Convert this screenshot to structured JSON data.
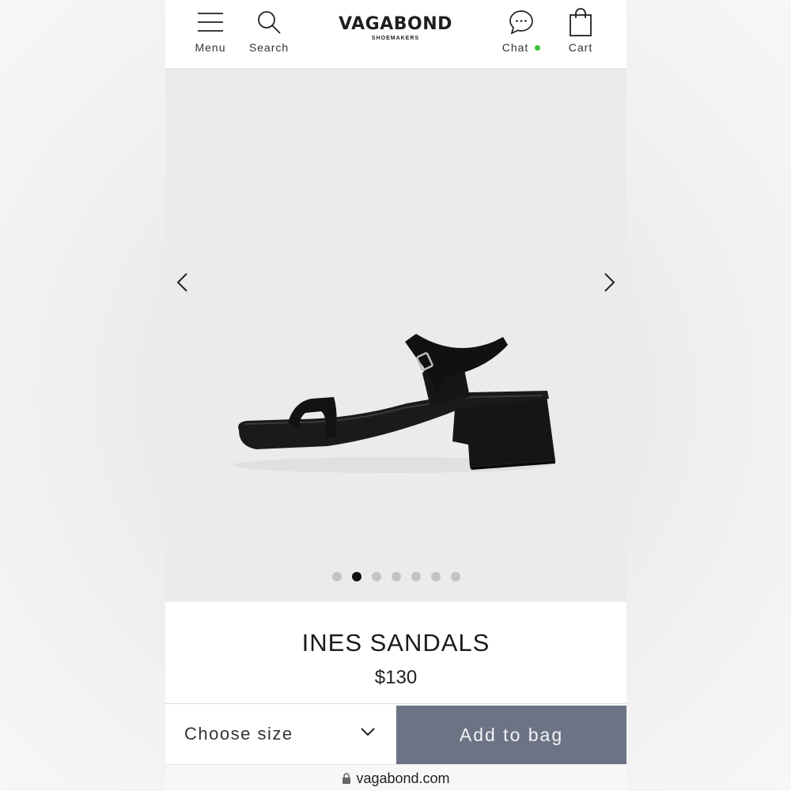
{
  "header": {
    "menu_label": "Menu",
    "search_label": "Search",
    "brand": "VAGABOND",
    "brand_sub": "SHOEMAKERS",
    "chat_label": "Chat",
    "chat_status_color": "#3cc13b",
    "cart_label": "Cart"
  },
  "gallery": {
    "image_count": 7,
    "active_index": 1
  },
  "product": {
    "title": "INES SANDALS",
    "price": "$130"
  },
  "actions": {
    "size_placeholder": "Choose size",
    "add_to_bag_label": "Add to bag",
    "add_to_bag_color": "#6c7384"
  },
  "browser": {
    "url": "vagabond.com"
  }
}
